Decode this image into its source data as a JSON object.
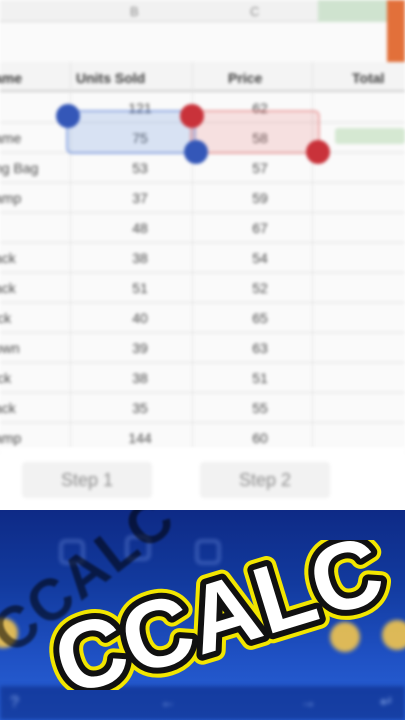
{
  "sheet": {
    "column_letters": [
      "B",
      "C"
    ],
    "headers": {
      "name": "ame",
      "units": "Units Sold",
      "price": "Price",
      "total": "Total"
    },
    "rows": [
      {
        "name": "",
        "units": "121",
        "price": "62"
      },
      {
        "name": "ame",
        "units": "75",
        "price": "58"
      },
      {
        "name": "ng Bag",
        "units": "53",
        "price": "57"
      },
      {
        "name": "amp",
        "units": "37",
        "price": "59"
      },
      {
        "name": "",
        "units": "48",
        "price": "67"
      },
      {
        "name": "ack",
        "units": "38",
        "price": "54"
      },
      {
        "name": "ack",
        "units": "51",
        "price": "52"
      },
      {
        "name": "ick",
        "units": "40",
        "price": "65"
      },
      {
        "name": "own",
        "units": "39",
        "price": "63"
      },
      {
        "name": "ick",
        "units": "38",
        "price": "51"
      },
      {
        "name": "ack",
        "units": "35",
        "price": "55"
      },
      {
        "name": "amp",
        "units": "144",
        "price": "60"
      }
    ]
  },
  "steps": {
    "step1": "Step 1",
    "step2": "Step 2"
  },
  "logo": {
    "text": "CCALC",
    "shadow_text": "CCALC",
    "fill_color": "#ffffff",
    "outline_color": "#111111",
    "glow_color": "#f2e600"
  },
  "colors": {
    "keyboard_top": "#0e2a86",
    "keyboard_bottom": "#2a63d8",
    "selection_blue": "#3457b8",
    "selection_red": "#c9323a",
    "accent_orange": "#e2703a"
  }
}
